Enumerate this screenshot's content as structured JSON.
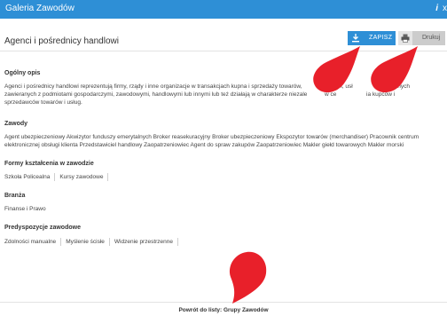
{
  "titlebar": {
    "title": "Galeria Zawodów",
    "info_glyph": "i",
    "close_glyph": "x"
  },
  "page": {
    "title": "Agenci i pośrednicy handlowi"
  },
  "toolbar": {
    "save_label": "ZAPISZ",
    "save_icon": "download-icon",
    "print_label": "Drukuj",
    "print_icon": "printer-icon"
  },
  "sections": {
    "overview": {
      "heading": "Ogólny opis",
      "line1a": "Agenci i pośrednicy handlowi reprezentują firmy, rządy i inne organizacje w transakcjach kupna i sprzedaży towarów,",
      "line1b": "h, usł",
      "line1c": "ch i innych",
      "line2a": "zawieranych z podmiotami gospodarczymi, zawodowymi, handlowymi lub innymi lub też działają w charakterze niezale",
      "line2b": "w ce",
      "line2c": "ia kupców i",
      "line3": "sprzedawców towarów i usług."
    },
    "occupations": {
      "heading": "Zawody",
      "text": "Agent ubezpieczeniowy Akwizytor funduszy emerytalnych Broker reasekuracyjny Broker ubezpieczeniowy Ekspozytor towarów (merchandiser) Pracownik centrum elektronicznej obsługi klienta Przedstawiciel handlowy Zaopatrzeniowiec Agent do spraw zakupów Zaopatrzeniowiec Makler giełd towarowych Makler morski"
    },
    "education": {
      "heading": "Formy kształcenia w zawodzie",
      "items": [
        "Szkoła Policealna",
        "Kursy zawodowe"
      ]
    },
    "industry": {
      "heading": "Branża",
      "text": "Finanse i Prawo"
    },
    "predispositions": {
      "heading": "Predyspozycje zawodowe",
      "items": [
        "Zdolności manualne",
        "Myślenie ścisłe",
        "Widzenie przestrzenne"
      ]
    }
  },
  "footer": {
    "back_link": "Powrót do listy: Grupy Zawodów"
  },
  "colors": {
    "accent": "#2e8fd6",
    "marker": "#e8202a",
    "print_button": "#cccccc"
  }
}
